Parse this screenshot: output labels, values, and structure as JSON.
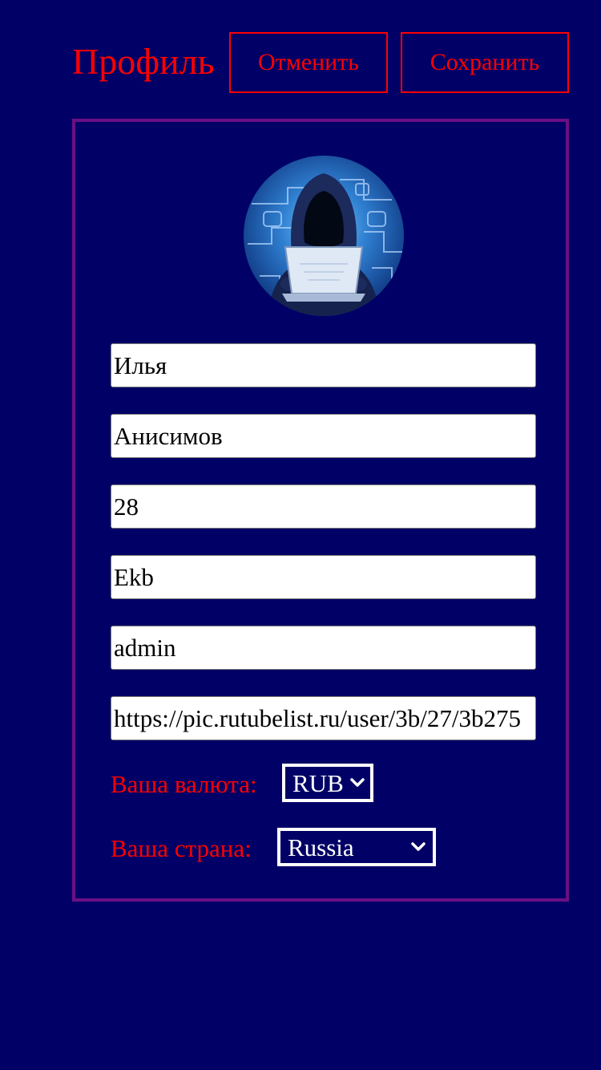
{
  "header": {
    "title": "Профиль",
    "cancel_label": "Отменить",
    "save_label": "Сохранить"
  },
  "profile": {
    "fields": {
      "first_name": "Илья",
      "last_name": "Анисимов",
      "age": "28",
      "city": "Ekb",
      "role": "admin",
      "avatar_url": "https://pic.rutubelist.ru/user/3b/27/3b275"
    },
    "currency": {
      "label": "Ваша валюта:",
      "value": "RUB"
    },
    "country": {
      "label": "Ваша страна:",
      "value": "Russia"
    }
  },
  "colors": {
    "background": "#000066",
    "accent": "#ff0000",
    "card_border": "#6b0f86"
  }
}
